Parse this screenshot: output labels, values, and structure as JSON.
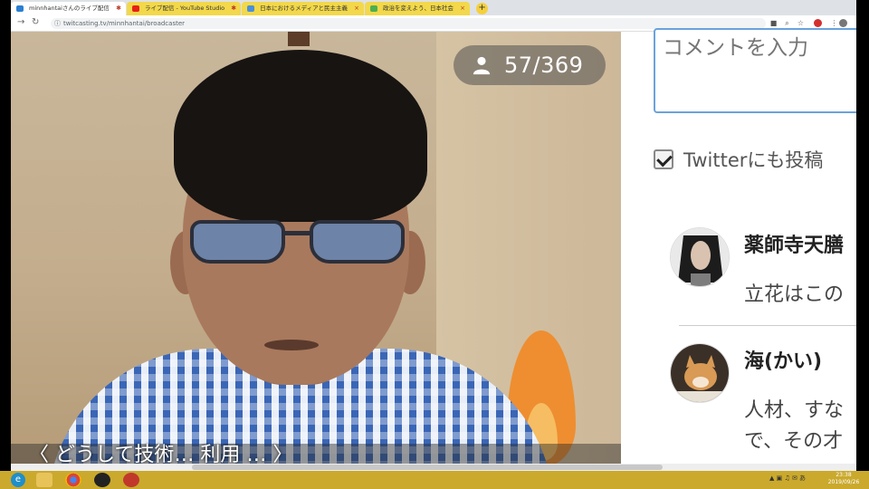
{
  "browser": {
    "tabs": [
      {
        "label": "minnhantaiさんのライブ配信",
        "active": true
      },
      {
        "label": "ライブ配信 - YouTube Studio",
        "active": false
      },
      {
        "label": "日本におけるメディアと民主主義",
        "active": false
      },
      {
        "label": "政治を変えよう、日本社会",
        "active": false
      }
    ],
    "new_tab_glyph": "+",
    "url": "twitcasting.tv/minnhantai/broadcaster"
  },
  "video": {
    "viewer_count": "57/369",
    "caption": "〈 どうして技術… 利用 … 〉"
  },
  "comment_panel": {
    "input_placeholder": "コメントを入力",
    "twitter_label": "Twitterにも投稿",
    "twitter_checked": true,
    "comments": [
      {
        "name": "薬師寺天膳",
        "text": "立花はこの"
      },
      {
        "name": "海(かい)",
        "text": "人材、すな",
        "text2": "で、その才"
      }
    ]
  },
  "taskbar": {
    "clock_time": "23:38",
    "clock_date": "2019/09/26",
    "tray_icons": "▲ ▣ ♫ ✉ あ"
  }
}
